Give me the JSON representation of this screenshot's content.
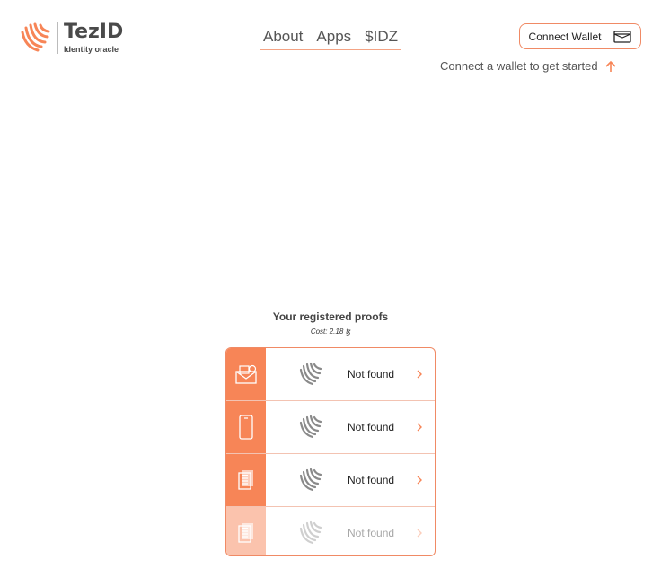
{
  "logo": {
    "title": "TezID",
    "subtitle": "Identity oracle",
    "icon": "fingerprint-icon"
  },
  "nav": {
    "items": [
      "About",
      "Apps",
      "$IDZ"
    ]
  },
  "wallet": {
    "button_label": "Connect Wallet",
    "hint": "Connect a wallet to get started",
    "icon": "wallet-icon"
  },
  "proofs": {
    "title": "Your registered proofs",
    "cost": "Cost: 2.18 ꜩ",
    "rows": [
      {
        "type": "email",
        "icon": "envelope-icon",
        "status": "Not found"
      },
      {
        "type": "phone",
        "icon": "phone-icon",
        "status": "Not found"
      },
      {
        "type": "document",
        "icon": "document-icon",
        "status": "Not found"
      },
      {
        "type": "document-2",
        "icon": "document-icon",
        "status": "Not found"
      }
    ]
  },
  "colors": {
    "accent": "#f78557",
    "accent_light": "#fbc3ad"
  }
}
